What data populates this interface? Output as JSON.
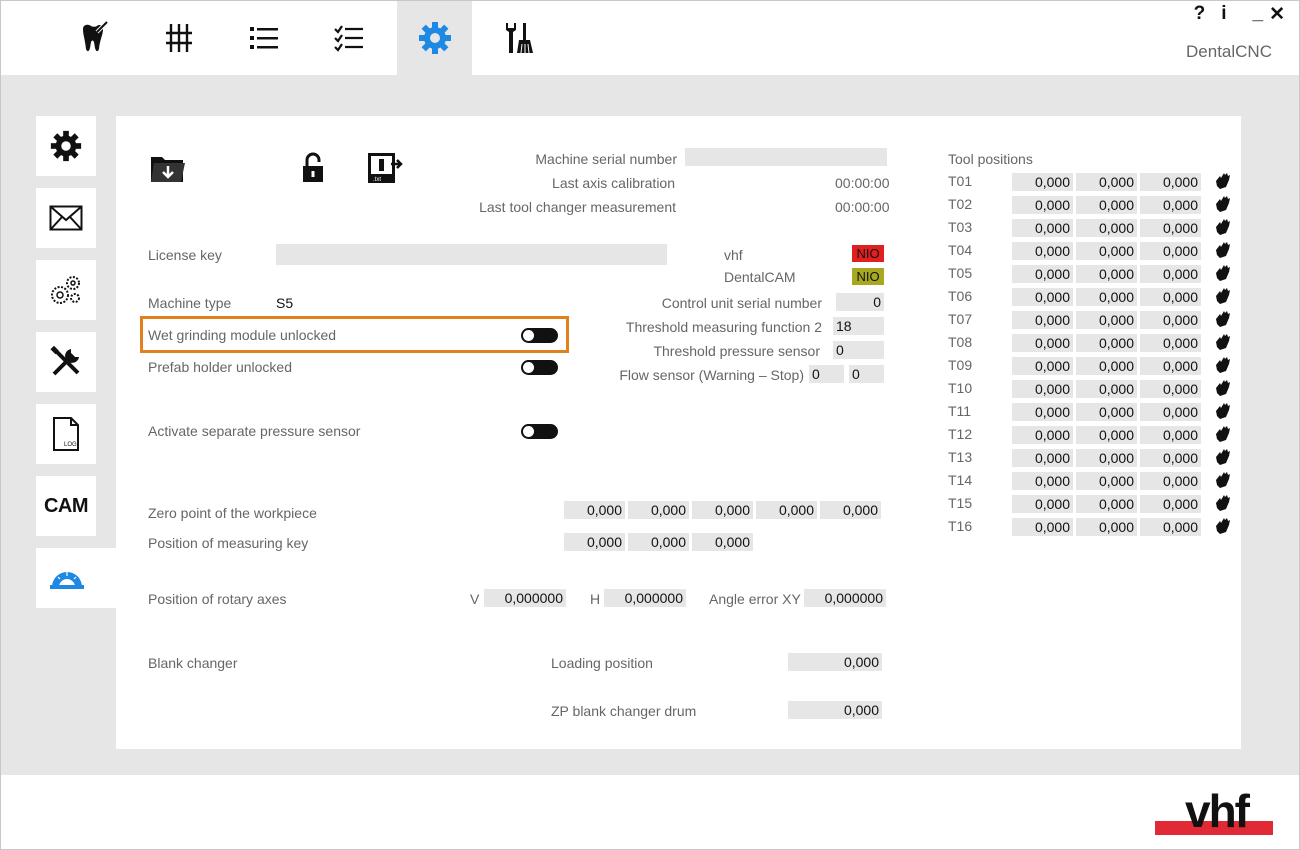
{
  "window": {
    "title": "DentalCNC",
    "help_label": "?",
    "info_label": "i",
    "minimize_label": "_",
    "close_label": "✕"
  },
  "topnav": [
    {
      "name": "tooth-tab",
      "icon": "tooth-icon"
    },
    {
      "name": "axes-tab",
      "icon": "sliders-icon"
    },
    {
      "name": "list-tab",
      "icon": "list-icon"
    },
    {
      "name": "checklist-tab",
      "icon": "checklist-icon"
    },
    {
      "name": "settings-tab",
      "icon": "gear-icon",
      "active": true
    },
    {
      "name": "maintenance-tab",
      "icon": "wrench-brush-icon"
    }
  ],
  "sidetabs": [
    {
      "name": "general-settings",
      "icon": "gear-icon"
    },
    {
      "name": "messages",
      "icon": "envelope-icon"
    },
    {
      "name": "advanced-settings",
      "icon": "gears-icon"
    },
    {
      "name": "tools",
      "icon": "tools-icon"
    },
    {
      "name": "log",
      "icon": "log-file-icon",
      "label": "LOG"
    },
    {
      "name": "cam",
      "label": "CAM"
    },
    {
      "name": "calibration",
      "icon": "protractor-icon",
      "active": true
    }
  ],
  "accent_color": "#1e88e5",
  "highlight_color": "#e0811e",
  "machine": {
    "serial_label": "Machine serial number",
    "serial_value": "",
    "axis_cal_label": "Last axis calibration",
    "axis_cal_value": "00:00:00",
    "tool_changer_label": "Last tool changer measurement",
    "tool_changer_value": "00:00:00"
  },
  "license": {
    "label": "License key",
    "value": "",
    "vhf_label": "vhf",
    "vhf_status": "NIO",
    "vhf_color": "#e02020",
    "dentalcam_label": "DentalCAM",
    "dentalcam_status": "NIO",
    "dentalcam_color": "#a8a820"
  },
  "machine_type": {
    "label": "Machine type",
    "value": "S5"
  },
  "toggles": {
    "wet_grinding": "Wet grinding module unlocked",
    "prefab_holder": "Prefab holder unlocked",
    "pressure_sensor": "Activate separate pressure sensor"
  },
  "control": {
    "serial_label": "Control unit serial number",
    "serial_value": "0",
    "threshold_measuring_label": "Threshold measuring function 2",
    "threshold_measuring_value": "18",
    "threshold_pressure_label": "Threshold pressure sensor",
    "threshold_pressure_value": "0",
    "flow_label": "Flow sensor (Warning – Stop)",
    "flow_warning": "0",
    "flow_stop": "0"
  },
  "zero_point": {
    "label": "Zero point of the workpiece",
    "values": [
      "0,000",
      "0,000",
      "0,000",
      "0,000",
      "0,000"
    ]
  },
  "measuring_key": {
    "label": "Position of measuring key",
    "values": [
      "0,000",
      "0,000",
      "0,000"
    ]
  },
  "rotary": {
    "label": "Position of rotary axes",
    "v_label": "V",
    "v_value": "0,000000",
    "h_label": "H",
    "h_value": "0,000000",
    "angle_label": "Angle error XY",
    "angle_value": "0,000000"
  },
  "blank_changer": {
    "label": "Blank changer",
    "loading_label": "Loading position",
    "loading_value": "0,000",
    "zp_label": "ZP blank changer drum",
    "zp_value": "0,000"
  },
  "tools": {
    "title": "Tool positions",
    "rows": [
      {
        "id": "T01",
        "x": "0,000",
        "y": "0,000",
        "z": "0,000"
      },
      {
        "id": "T02",
        "x": "0,000",
        "y": "0,000",
        "z": "0,000"
      },
      {
        "id": "T03",
        "x": "0,000",
        "y": "0,000",
        "z": "0,000"
      },
      {
        "id": "T04",
        "x": "0,000",
        "y": "0,000",
        "z": "0,000"
      },
      {
        "id": "T05",
        "x": "0,000",
        "y": "0,000",
        "z": "0,000"
      },
      {
        "id": "T06",
        "x": "0,000",
        "y": "0,000",
        "z": "0,000"
      },
      {
        "id": "T07",
        "x": "0,000",
        "y": "0,000",
        "z": "0,000"
      },
      {
        "id": "T08",
        "x": "0,000",
        "y": "0,000",
        "z": "0,000"
      },
      {
        "id": "T09",
        "x": "0,000",
        "y": "0,000",
        "z": "0,000"
      },
      {
        "id": "T10",
        "x": "0,000",
        "y": "0,000",
        "z": "0,000"
      },
      {
        "id": "T11",
        "x": "0,000",
        "y": "0,000",
        "z": "0,000"
      },
      {
        "id": "T12",
        "x": "0,000",
        "y": "0,000",
        "z": "0,000"
      },
      {
        "id": "T13",
        "x": "0,000",
        "y": "0,000",
        "z": "0,000"
      },
      {
        "id": "T14",
        "x": "0,000",
        "y": "0,000",
        "z": "0,000"
      },
      {
        "id": "T15",
        "x": "0,000",
        "y": "0,000",
        "z": "0,000"
      },
      {
        "id": "T16",
        "x": "0,000",
        "y": "0,000",
        "z": "0,000"
      }
    ]
  },
  "brand": {
    "logo": "vhf",
    "logo_color": "#e02a35"
  }
}
